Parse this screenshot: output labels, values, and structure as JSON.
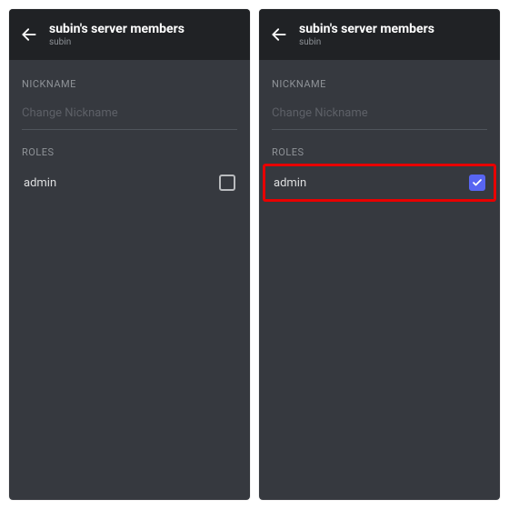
{
  "header": {
    "title": "subin's server members",
    "subtitle": "subin"
  },
  "sections": {
    "nickname_label": "NICKNAME",
    "nickname_placeholder": "Change Nickname",
    "roles_label": "ROLES"
  },
  "roles": {
    "admin_label": "admin"
  },
  "panels": {
    "left": {
      "admin_checked": false,
      "highlight": false
    },
    "right": {
      "admin_checked": true,
      "highlight": true
    }
  },
  "colors": {
    "bg": "#36393f",
    "header_bg": "#202225",
    "accent": "#5865f2",
    "highlight": "#e80000"
  }
}
